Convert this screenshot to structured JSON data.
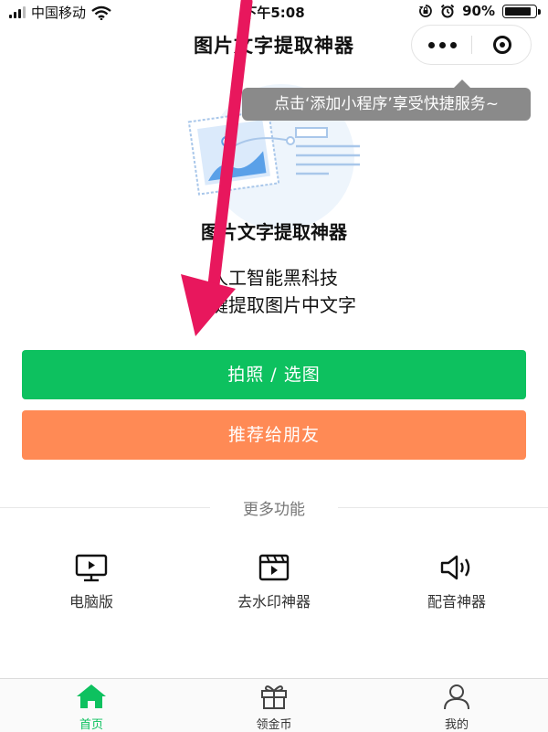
{
  "status_bar": {
    "carrier": "中国移动",
    "time": "下午5:08",
    "battery_text": "90%",
    "battery_level": 0.9
  },
  "nav": {
    "title": "图片文字提取神器",
    "more_icon": "ellipsis-icon",
    "close_icon": "target-circle-icon"
  },
  "tooltip": {
    "text": "点击‘添加小程序’享受快捷服务~"
  },
  "hero": {
    "title": "图片文字提取神器",
    "tagline_line1": "人工智能黑科技",
    "tagline_line2": "一键提取图片中文字"
  },
  "buttons": {
    "photo_label": "拍照 / 选图",
    "share_label": "推荐给朋友"
  },
  "more_section": {
    "title": "更多功能",
    "items": [
      {
        "label": "电脑版",
        "icon": "monitor-icon"
      },
      {
        "label": "去水印神器",
        "icon": "clapperboard-icon"
      },
      {
        "label": "配音神器",
        "icon": "speaker-icon"
      }
    ]
  },
  "tab_bar": {
    "items": [
      {
        "label": "首页",
        "icon": "home-icon",
        "active": true
      },
      {
        "label": "领金币",
        "icon": "gift-icon",
        "active": false
      },
      {
        "label": "我的",
        "icon": "user-icon",
        "active": false
      }
    ]
  },
  "colors": {
    "primary_green": "#0dc15f",
    "share_orange": "#ff8a55",
    "tooltip_gray": "#8a8a8a",
    "annotation_arrow": "#e8175d"
  }
}
